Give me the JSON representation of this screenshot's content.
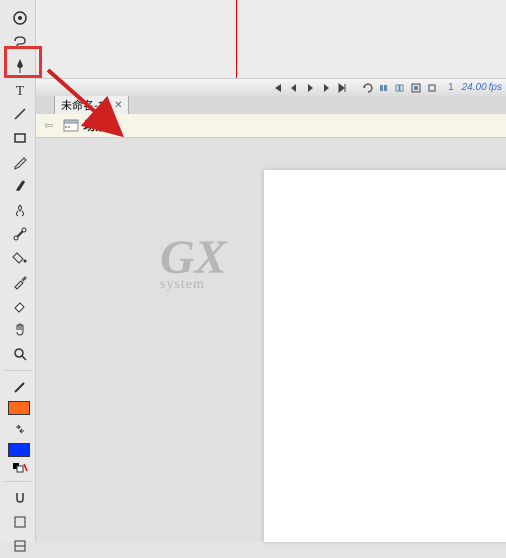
{
  "toolbox": {
    "tools": [
      {
        "name": "free-transform-tool"
      },
      {
        "name": "lasso-tool"
      },
      {
        "name": "pen-tool"
      },
      {
        "name": "text-tool"
      },
      {
        "name": "line-tool"
      },
      {
        "name": "rectangle-tool"
      },
      {
        "name": "pencil-tool"
      },
      {
        "name": "brush-tool"
      },
      {
        "name": "deco-tool"
      },
      {
        "name": "bone-tool"
      },
      {
        "name": "paint-bucket-tool"
      },
      {
        "name": "eyedropper-tool"
      },
      {
        "name": "eraser-tool"
      },
      {
        "name": "hand-tool"
      },
      {
        "name": "zoom-tool"
      }
    ],
    "colors": {
      "stroke_icon": "pencil-stroke-icon",
      "fill": "#ff6b1a",
      "fill2": "#ffffff",
      "fill3": "#0033ff"
    },
    "options": [
      {
        "name": "snap-option"
      },
      {
        "name": "smooth-option"
      },
      {
        "name": "straighten-option"
      }
    ]
  },
  "timeline": {
    "current_frame": "1",
    "fps": "24.00",
    "fps_unit": "fps",
    "controls": [
      "first-frame",
      "prev-frame",
      "play",
      "next-frame",
      "last-frame",
      "loop",
      "onion-skin",
      "onion-outline",
      "edit-multiple",
      "center-frame"
    ]
  },
  "tabs": [
    {
      "label": "未命名-1*"
    }
  ],
  "scene": {
    "label": "场景 1"
  },
  "watermark": {
    "big": "GX",
    "sub": "system"
  }
}
